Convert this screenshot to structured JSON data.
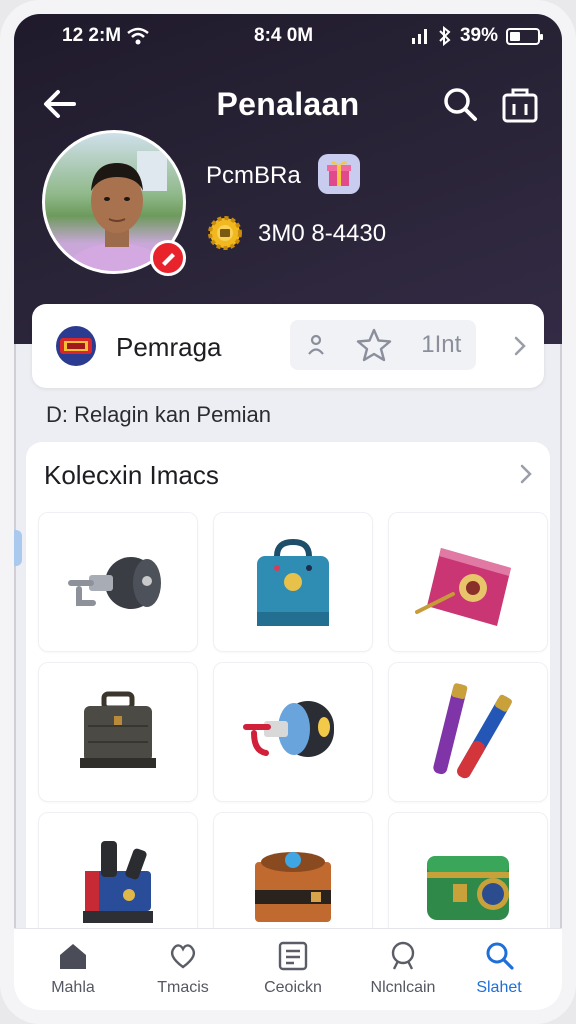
{
  "status_bar": {
    "left_text": "12 2:M",
    "time": "8:4 0M",
    "battery_text": "39%",
    "battery_level": 0.39
  },
  "header": {
    "title": "Penalaan"
  },
  "profile": {
    "username": "PcmBRa",
    "coins": "3M0 8-4430"
  },
  "level_card": {
    "name": "Pemraga",
    "action_text": "1Int"
  },
  "subtitle": "D: Relagin kan Pemian",
  "collection": {
    "title": "Kolecxin Imacs",
    "items": [
      {
        "icon": "winch-icon"
      },
      {
        "icon": "blue-bag-icon"
      },
      {
        "icon": "pink-box-icon"
      },
      {
        "icon": "briefcase-icon"
      },
      {
        "icon": "blue-winch-icon"
      },
      {
        "icon": "tubes-icon"
      },
      {
        "icon": "machine-icon"
      },
      {
        "icon": "wooden-box-icon"
      },
      {
        "icon": "treasure-chest-icon"
      }
    ]
  },
  "bottom_nav": [
    {
      "label": "Mahla",
      "icon": "home-icon"
    },
    {
      "label": "Tmacis",
      "icon": "heart-chat-icon"
    },
    {
      "label": "Ceoickn",
      "icon": "calendar-icon"
    },
    {
      "label": "Nlcnlcain",
      "icon": "user-icon"
    },
    {
      "label": "Slahet",
      "icon": "search-icon",
      "active": true
    }
  ],
  "colors": {
    "accent": "#1f6fd9",
    "header_bg": "#241e31",
    "edit_badge": "#e8232b"
  }
}
